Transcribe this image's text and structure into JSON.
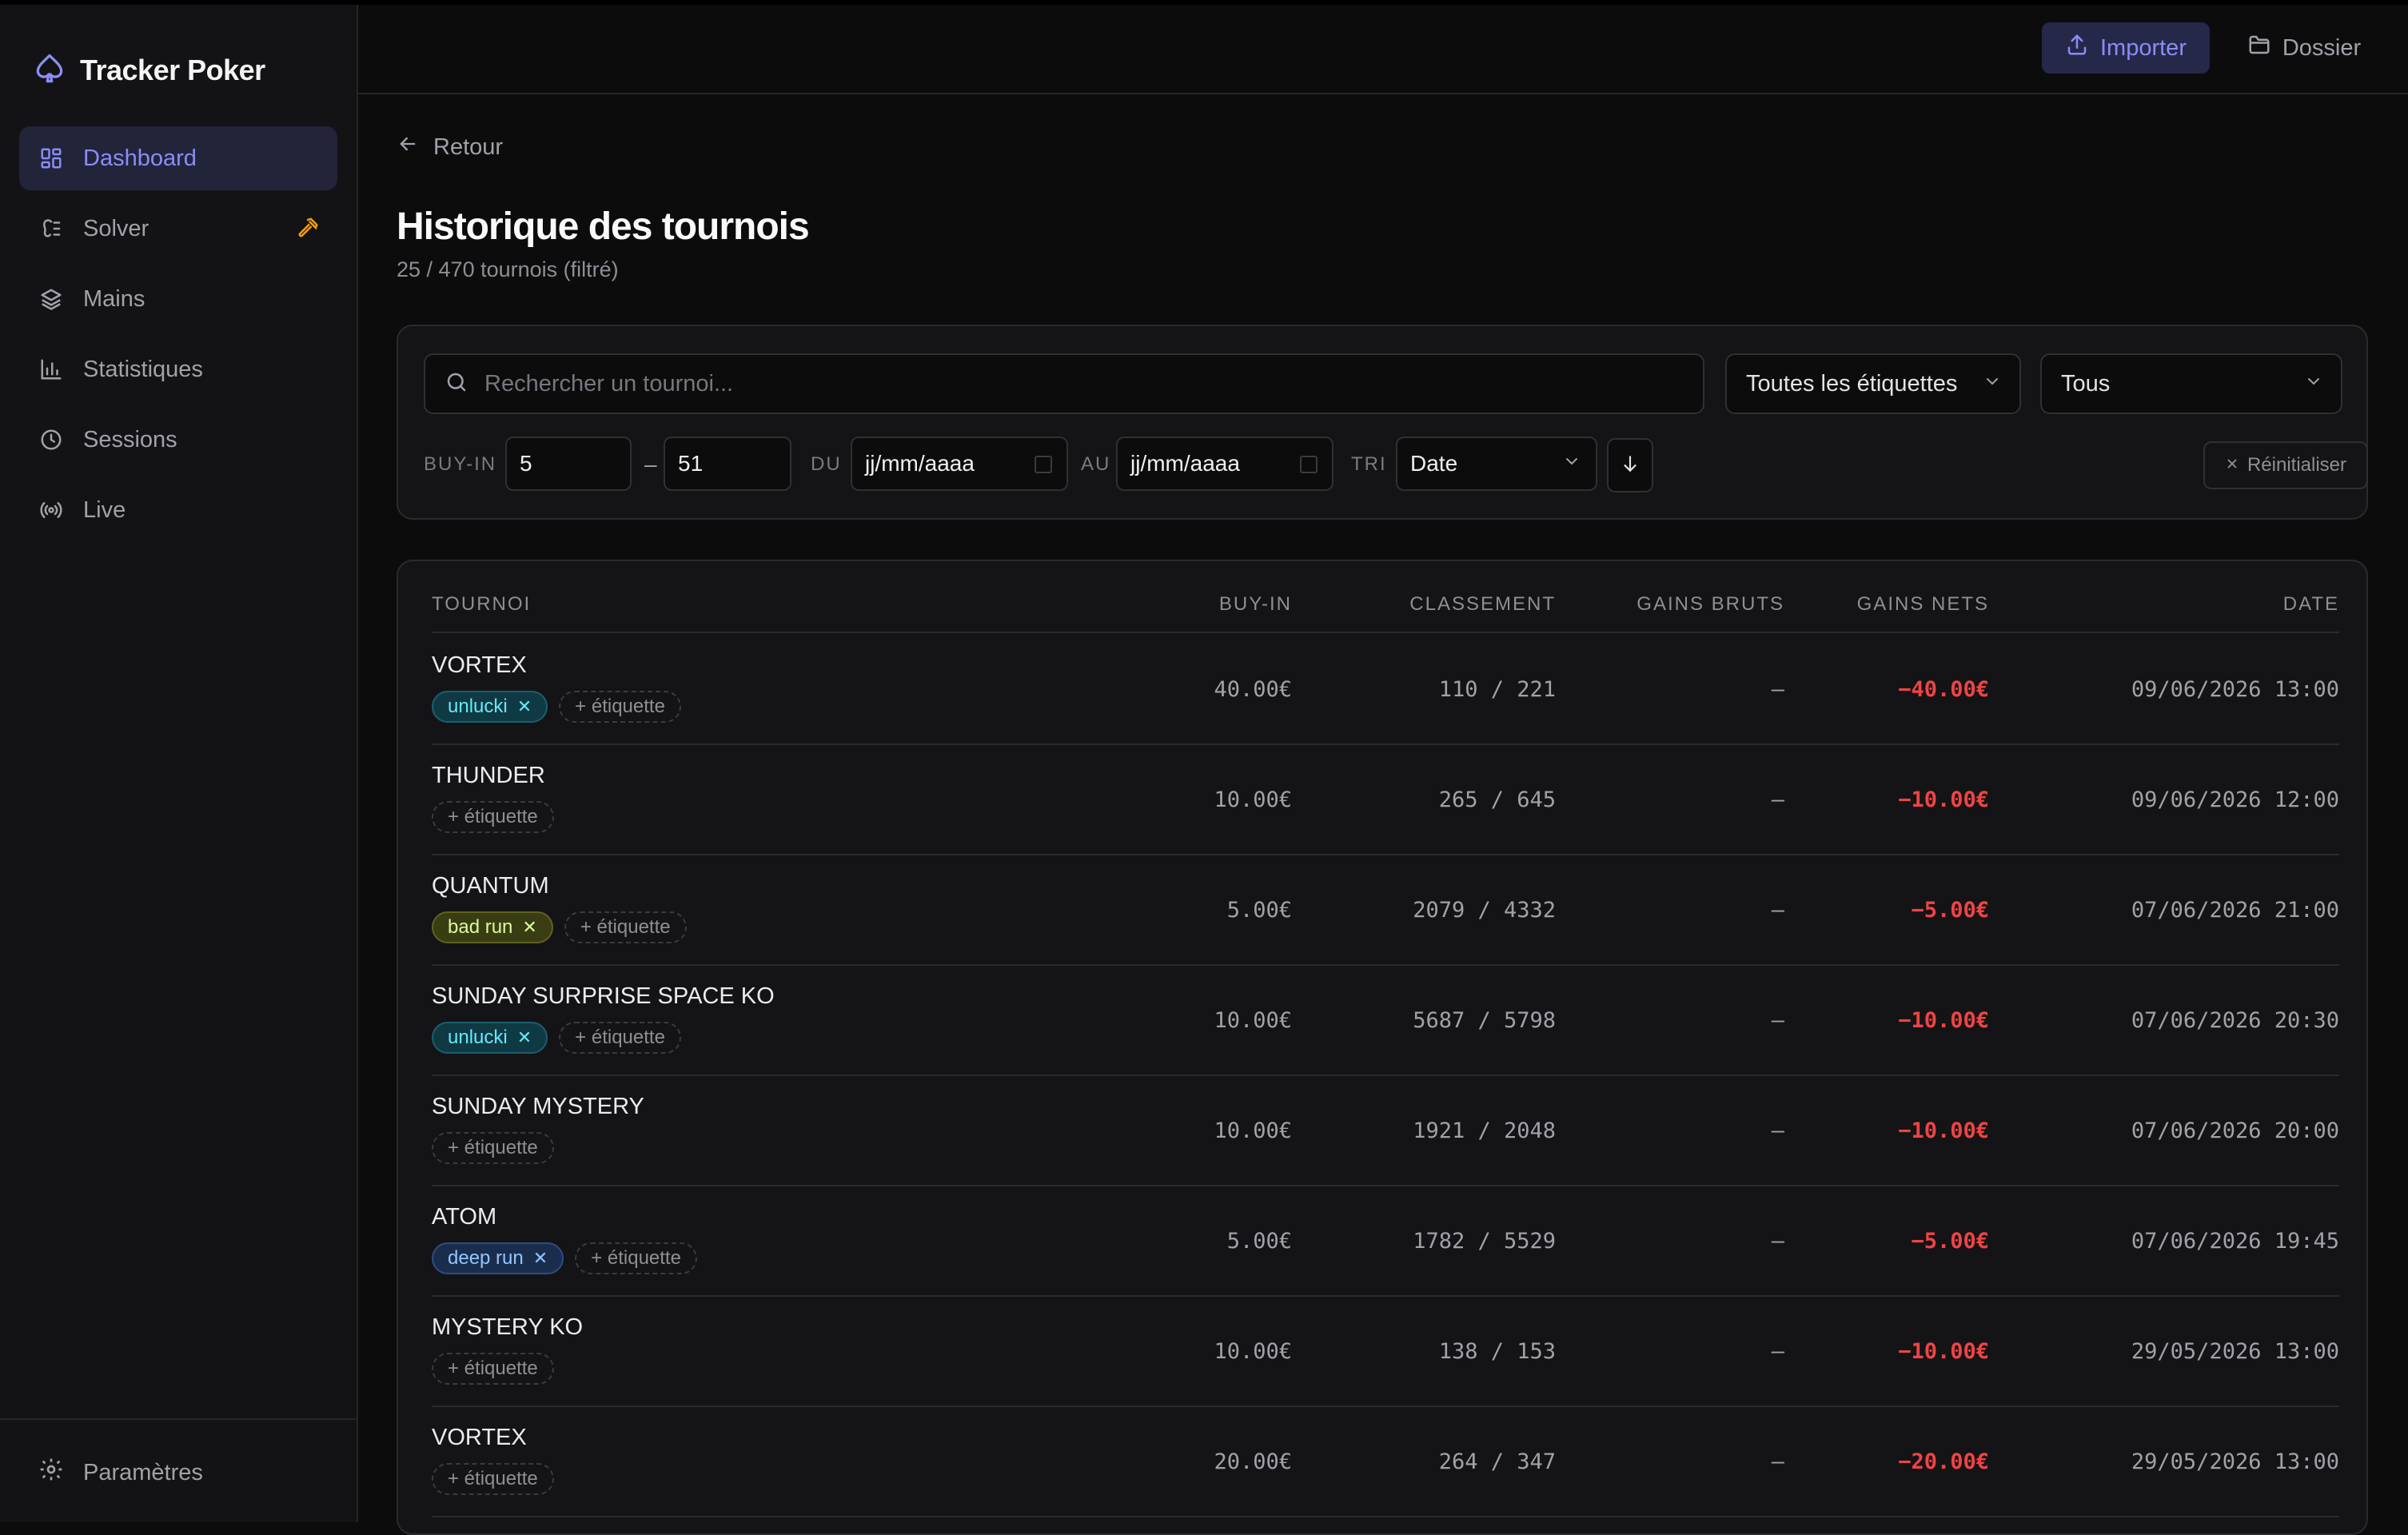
{
  "app": {
    "name": "Tracker Poker"
  },
  "sidebar": {
    "items": [
      {
        "label": "Dashboard",
        "icon": "dashboard-icon",
        "active": true
      },
      {
        "label": "Solver",
        "icon": "solver-icon",
        "active": false
      },
      {
        "label": "Mains",
        "icon": "layers-icon",
        "active": false
      },
      {
        "label": "Statistiques",
        "icon": "bar-chart-icon",
        "active": false
      },
      {
        "label": "Sessions",
        "icon": "clock-icon",
        "active": false
      },
      {
        "label": "Live",
        "icon": "broadcast-icon",
        "active": false
      }
    ],
    "settings_label": "Paramètres"
  },
  "header": {
    "import_label": "Importer",
    "folder_label": "Dossier"
  },
  "page": {
    "back_label": "Retour",
    "title": "Historique des tournois",
    "subtitle": "25 / 470 tournois (filtré)"
  },
  "filters": {
    "search_placeholder": "Rechercher un tournoi...",
    "tags_select": "Toutes les étiquettes",
    "status_select": "Tous",
    "buyin_label": "BUY-IN",
    "buyin_min": "5",
    "buyin_sep": "–",
    "buyin_max": "51",
    "from_label": "DU",
    "from_value": "jj/mm/aaaa",
    "to_label": "AU",
    "to_value": "jj/mm/aaaa",
    "sort_label": "TRI",
    "sort_value": "Date",
    "reset_label": "Réinitialiser"
  },
  "table": {
    "headers": {
      "tournament": "TOURNOI",
      "buyin": "BUY-IN",
      "rank": "CLASSEMENT",
      "gross": "GAINS BRUTS",
      "net": "GAINS NETS",
      "date": "DATE"
    },
    "add_tag_label": "+ étiquette",
    "rows": [
      {
        "name": "VORTEX",
        "tags": [
          {
            "label": "unlucki",
            "color": "teal"
          }
        ],
        "buyin": "40.00€",
        "rank": "110 / 221",
        "gross": "—",
        "net": "−40.00€",
        "date": "09/06/2026 13:00"
      },
      {
        "name": "THUNDER",
        "tags": [],
        "buyin": "10.00€",
        "rank": "265 / 645",
        "gross": "—",
        "net": "−10.00€",
        "date": "09/06/2026 12:00"
      },
      {
        "name": "QUANTUM",
        "tags": [
          {
            "label": "bad run",
            "color": "olive"
          }
        ],
        "buyin": "5.00€",
        "rank": "2079 / 4332",
        "gross": "—",
        "net": "−5.00€",
        "date": "07/06/2026 21:00"
      },
      {
        "name": "SUNDAY SURPRISE SPACE KO",
        "tags": [
          {
            "label": "unlucki",
            "color": "teal"
          }
        ],
        "buyin": "10.00€",
        "rank": "5687 / 5798",
        "gross": "—",
        "net": "−10.00€",
        "date": "07/06/2026 20:30"
      },
      {
        "name": "SUNDAY MYSTERY",
        "tags": [],
        "buyin": "10.00€",
        "rank": "1921 / 2048",
        "gross": "—",
        "net": "−10.00€",
        "date": "07/06/2026 20:00"
      },
      {
        "name": "ATOM",
        "tags": [
          {
            "label": "deep run",
            "color": "blue"
          }
        ],
        "buyin": "5.00€",
        "rank": "1782 / 5529",
        "gross": "—",
        "net": "−5.00€",
        "date": "07/06/2026 19:45"
      },
      {
        "name": "MYSTERY KO",
        "tags": [],
        "buyin": "10.00€",
        "rank": "138 / 153",
        "gross": "—",
        "net": "−10.00€",
        "date": "29/05/2026 13:00"
      },
      {
        "name": "VORTEX",
        "tags": [],
        "buyin": "20.00€",
        "rank": "264 / 347",
        "gross": "—",
        "net": "−20.00€",
        "date": "29/05/2026 13:00"
      }
    ]
  },
  "colors": {
    "accent": "#8b8cf6",
    "negative": "#ef4444",
    "solver_badge": "#f59e0b",
    "tag_teal": "#67e8f9",
    "tag_olive": "#d9f99d",
    "tag_blue": "#93c5fd"
  }
}
